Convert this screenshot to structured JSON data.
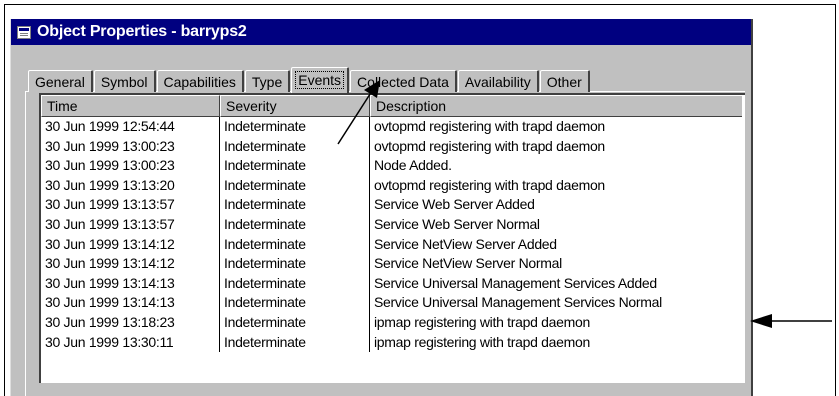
{
  "window": {
    "title": "Object Properties - barryps2"
  },
  "tabs": [
    {
      "label": "General"
    },
    {
      "label": "Symbol"
    },
    {
      "label": "Capabilities"
    },
    {
      "label": "Type"
    },
    {
      "label": "Events"
    },
    {
      "label": "Collected Data"
    },
    {
      "label": "Availability"
    },
    {
      "label": "Other"
    }
  ],
  "active_tab": "Events",
  "table": {
    "columns": [
      "Time",
      "Severity",
      "Description"
    ],
    "rows": [
      [
        "30 Jun 1999 12:54:44",
        "Indeterminate",
        "ovtopmd  registering with trapd daemon"
      ],
      [
        "30 Jun 1999 13:00:23",
        "Indeterminate",
        "ovtopmd  registering with trapd daemon"
      ],
      [
        "30 Jun 1999 13:00:23",
        "Indeterminate",
        "Node Added."
      ],
      [
        "30 Jun 1999 13:13:20",
        "Indeterminate",
        "ovtopmd  registering with trapd daemon"
      ],
      [
        "30 Jun 1999 13:13:57",
        "Indeterminate",
        "Service Web Server Added"
      ],
      [
        "30 Jun 1999 13:13:57",
        "Indeterminate",
        "Service Web Server Normal"
      ],
      [
        "30 Jun 1999 13:14:12",
        "Indeterminate",
        "Service NetView Server Added"
      ],
      [
        "30 Jun 1999 13:14:12",
        "Indeterminate",
        "Service NetView Server Normal"
      ],
      [
        "30 Jun 1999 13:14:13",
        "Indeterminate",
        "Service Universal Management Services Added"
      ],
      [
        "30 Jun 1999 13:14:13",
        "Indeterminate",
        "Service Universal Management Services Normal"
      ],
      [
        "30 Jun 1999 13:18:23",
        "Indeterminate",
        "ipmap  registering with trapd daemon"
      ],
      [
        "30 Jun 1999 13:30:11",
        "Indeterminate",
        "ipmap  registering with trapd daemon"
      ]
    ]
  },
  "colors": {
    "titlebar": "#000080",
    "window_face": "#c0c0c0",
    "list_bg": "#ffffff"
  },
  "icons": {
    "title": "window-icon",
    "callout_1": "arrow-icon",
    "callout_2": "arrow-icon"
  }
}
